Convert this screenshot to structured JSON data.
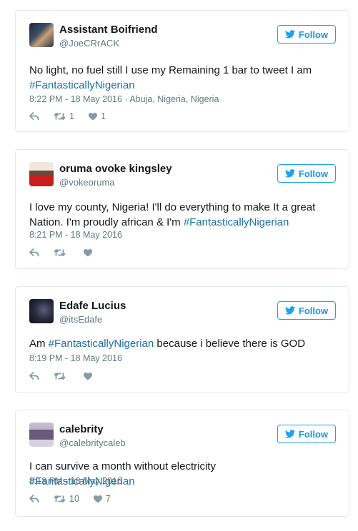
{
  "colors": {
    "brand": "#1da1f2",
    "hashtag": "#1b6fa8",
    "muted": "#657786",
    "icon": "#8899a6",
    "border": "#e1e8ed"
  },
  "tweets": [
    {
      "name": "Assistant Boifriend",
      "handle": "@JoeCRrACK",
      "follow_label": "Follow",
      "text_before": "No light, no fuel still I use my Remaining 1 bar to tweet I am ",
      "hashtag": "#FantasticallyNigerian",
      "text_after": "",
      "meta": "8:22 PM - 18 May 2016 · Abuja, Nigeria, Nigeria",
      "retweets": "1",
      "likes": "1"
    },
    {
      "name": "oruma ovoke kingsley",
      "handle": "@vokeoruma",
      "follow_label": "Follow",
      "text_before": "I love my county, Nigeria! I'll do everything to make It a great Nation. I'm proudly african & I'm ",
      "hashtag": "#FantasticallyNigerian",
      "text_after": "",
      "meta": "8:21 PM - 18 May 2016",
      "retweets": "",
      "likes": ""
    },
    {
      "name": "Edafe Lucius",
      "handle": "@itsEdafe",
      "follow_label": "Follow",
      "text_before": "Am ",
      "hashtag": "#FantasticallyNigerian",
      "text_after": " because i believe there is GOD",
      "meta": "8:19 PM - 18 May 2016",
      "retweets": "",
      "likes": ""
    },
    {
      "name": "calebrity",
      "handle": "@calebritycaleb",
      "follow_label": "Follow",
      "text_before": "I can survive a month without electricity ",
      "hashtag": "#FantasticallyNigerian",
      "text_after": "",
      "meta": "8:18 PM - 18 May 2016",
      "retweets": "10",
      "likes": "7"
    }
  ]
}
